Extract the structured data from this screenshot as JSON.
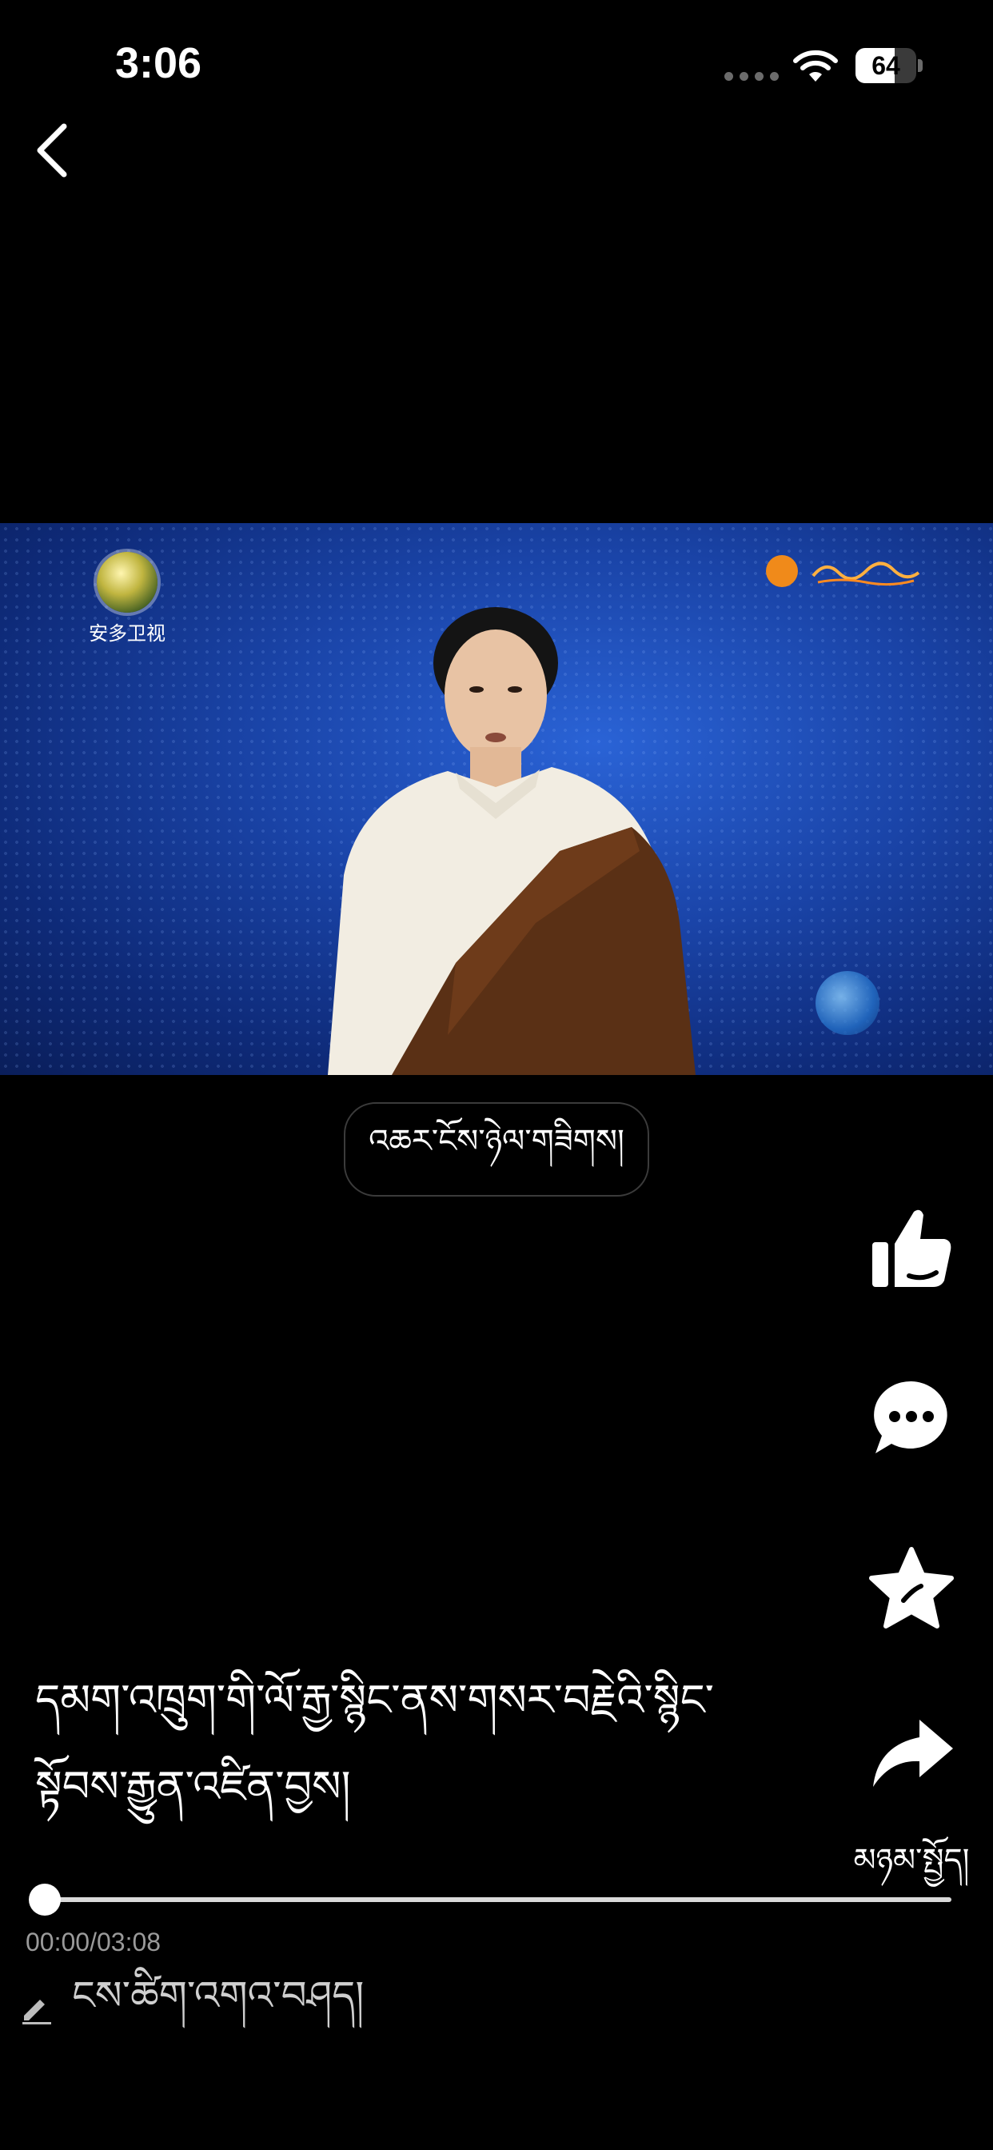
{
  "status_bar": {
    "time": "3:06",
    "battery_level": "64",
    "battery_fraction": 0.64,
    "icons": [
      "signal-dots-icon",
      "wifi-icon",
      "battery-icon"
    ]
  },
  "nav": {
    "back_icon": "chevron-left-icon"
  },
  "video": {
    "channel_logo_left_text": "安多卫视"
  },
  "tag_pill": {
    "label": "འཆར་ངོས་ཉེལ་གཟིགས།"
  },
  "actions": {
    "like_icon": "thumbs-up-icon",
    "comment_icon": "chat-bubble-icon",
    "favorite_icon": "star-icon",
    "share_icon": "share-arrow-icon",
    "share_label": "མཉམ་སྤྱོད།"
  },
  "caption": {
    "text": "དམག་འཁྲུག་གི་ལོ་རྒྱ་སྙིང་ནས་གསར་བརྗེའི་སྙིང་སྟོབས་རྒྱུན་འཛིན་བྱས།"
  },
  "playback": {
    "time_text": "00:00/03:08",
    "progress": 0.0
  },
  "comment_input": {
    "placeholder": "ངས་ཚིག་འགའ་བཤད།",
    "icon": "pencil-icon"
  },
  "colors": {
    "background": "#000000",
    "text": "#ffffff",
    "muted_text": "#9a9a9a",
    "video_blue": "#1a44a8"
  }
}
